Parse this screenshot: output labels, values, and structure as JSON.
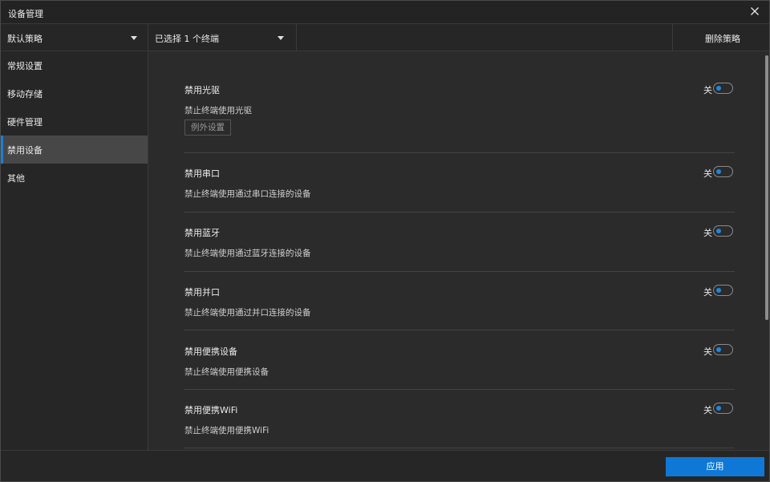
{
  "window": {
    "title": "设备管理"
  },
  "toolbar": {
    "policy_select": "默认策略",
    "terminal_select": "已选择 1 个终端",
    "delete_label": "删除策略"
  },
  "sidebar": {
    "items": [
      {
        "label": "常规设置",
        "active": false
      },
      {
        "label": "移动存储",
        "active": false
      },
      {
        "label": "硬件管理",
        "active": false
      },
      {
        "label": "禁用设备",
        "active": true
      },
      {
        "label": "其他",
        "active": false
      }
    ]
  },
  "sections": [
    {
      "title": "禁用光驱",
      "desc": "禁止终端使用光驱",
      "toggle": "关",
      "button": "例外设置"
    },
    {
      "title": "禁用串口",
      "desc": "禁止终端使用通过串口连接的设备",
      "toggle": "关"
    },
    {
      "title": "禁用蓝牙",
      "desc": "禁止终端使用通过蓝牙连接的设备",
      "toggle": "关"
    },
    {
      "title": "禁用并口",
      "desc": "禁止终端使用通过并口连接的设备",
      "toggle": "关"
    },
    {
      "title": "禁用便携设备",
      "desc": "禁止终端使用便携设备",
      "toggle": "关"
    },
    {
      "title": "禁用便携WiFi",
      "desc": "禁止终端使用便携WiFi",
      "toggle": "关"
    }
  ],
  "footer": {
    "apply_label": "应用"
  },
  "colors": {
    "accent": "#0f78d6",
    "background": "#2b2b2b",
    "panel": "#262626",
    "active_item": "#474747"
  }
}
